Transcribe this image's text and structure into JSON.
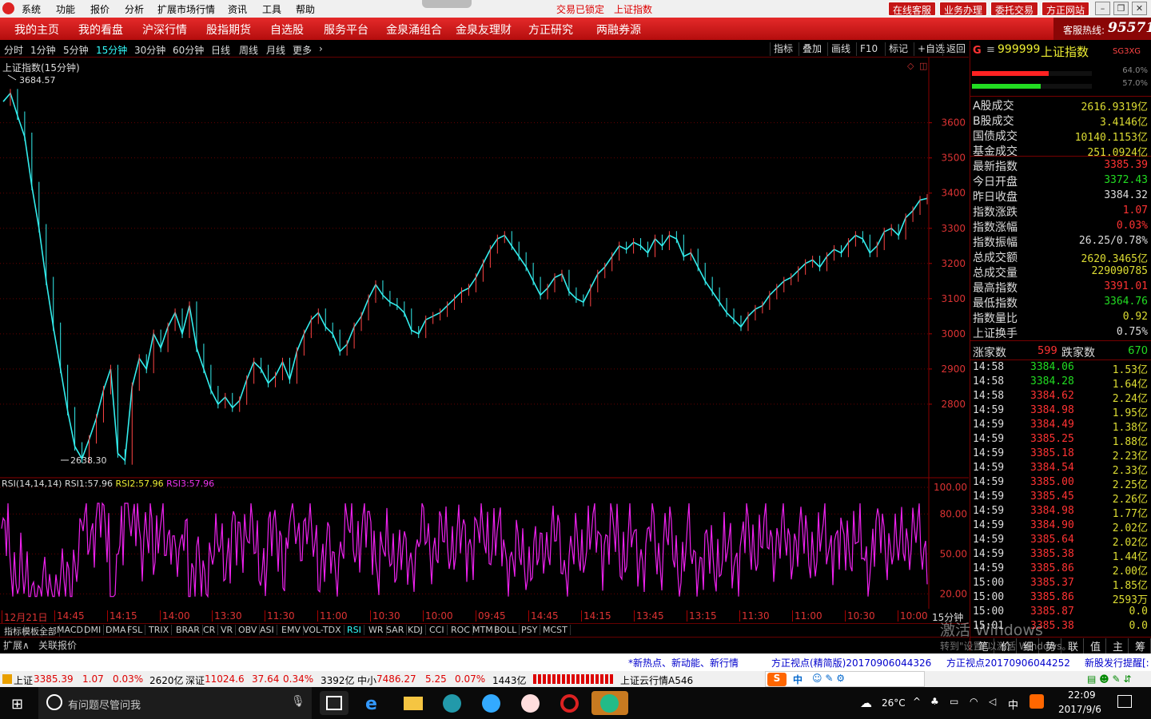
{
  "menu": {
    "items": [
      "系统",
      "功能",
      "报价",
      "分析",
      "扩展市场行情",
      "资讯",
      "工具",
      "帮助"
    ],
    "status": "交易已锁定",
    "title": "上证指数",
    "buttons": [
      "在线客服",
      "业务办理",
      "委托交易",
      "方正网站"
    ]
  },
  "nav": {
    "items": [
      "我的主页",
      "我的看盘",
      "沪深行情",
      "股指期货",
      "自选股",
      "服务平台",
      "金泉涌组合",
      "金泉友理财",
      "方正研究",
      "两融券源"
    ],
    "hotline_label": "客服热线:",
    "hotline": "95571"
  },
  "periods": {
    "items": [
      "分时",
      "1分钟",
      "5分钟",
      "15分钟",
      "30分钟",
      "60分钟",
      "日线",
      "周线",
      "月线",
      "更多"
    ],
    "active": 3
  },
  "tools": [
    "指标",
    "叠加",
    "画线",
    "F10",
    "标记",
    "+自选",
    "返回"
  ],
  "chart": {
    "title": "上证指数(15分钟)",
    "high_label": "3684.57",
    "low_label": "2638.30"
  },
  "rsi": {
    "name": "RSI(14,14,14)",
    "rsi1_label": "RSI1:",
    "rsi1": "57.96",
    "rsi2_label": "RSI2:",
    "rsi2": "57.96",
    "rsi3_label": "RSI3:",
    "rsi3": "57.96"
  },
  "chart_data": {
    "type": "line",
    "price_axis": {
      "ticks": [
        "3600",
        "3500",
        "3400",
        "3300",
        "3200",
        "3100",
        "3000",
        "2900",
        "2800"
      ],
      "ylim": [
        2600,
        3740
      ]
    },
    "rsi_axis": {
      "ticks": [
        "100.00",
        "80.00",
        "50.00",
        "20.00"
      ],
      "ylim": [
        10,
        100
      ]
    },
    "x_ticks": [
      "12月21日",
      "14:45",
      "14:15",
      "14:00",
      "13:30",
      "11:30",
      "11:00",
      "10:30",
      "10:00",
      "09:45",
      "14:45",
      "14:15",
      "13:45",
      "13:15",
      "11:30",
      "11:00",
      "10:30",
      "10:00"
    ],
    "x_unit": "15分钟",
    "series": [
      {
        "values": [
          3660,
          3684,
          3620,
          3560,
          3420,
          3300,
          3150,
          3020,
          2900,
          2780,
          2680,
          2645,
          2700,
          2760,
          2840,
          2900,
          2660,
          2640,
          2850,
          2930,
          2900,
          3000,
          2960,
          3020,
          3060,
          3000,
          3080,
          2960,
          2900,
          2840,
          2800,
          2820,
          2790,
          2810,
          2870,
          2920,
          2900,
          2860,
          2880,
          2920,
          2870,
          2950,
          3000,
          3040,
          3060,
          3020,
          3000,
          2950,
          2970,
          3020,
          3050,
          3100,
          3140,
          3110,
          3090,
          3080,
          3060,
          3010,
          3000,
          3040,
          3050,
          3060,
          3080,
          3100,
          3120,
          3130,
          3160,
          3200,
          3240,
          3270,
          3280,
          3250,
          3220,
          3190,
          3150,
          3110,
          3130,
          3160,
          3170,
          3120,
          3100,
          3090,
          3130,
          3170,
          3190,
          3220,
          3250,
          3240,
          3260,
          3250,
          3230,
          3270,
          3250,
          3280,
          3270,
          3220,
          3230,
          3190,
          3150,
          3120,
          3090,
          3060,
          3040,
          3020,
          3050,
          3070,
          3080,
          3110,
          3130,
          3150,
          3160,
          3180,
          3200,
          3210,
          3190,
          3220,
          3240,
          3230,
          3260,
          3280,
          3270,
          3230,
          3250,
          3290,
          3300,
          3280,
          3330,
          3350,
          3380,
          3385
        ]
      }
    ]
  },
  "right": {
    "code": "999999",
    "name": "上证指数",
    "tag": "SG3XG",
    "bar1_pct": "64.0%",
    "bar2_pct": "57.0%",
    "bar1_fill": 0.64,
    "bar2_fill": 0.57,
    "vol_rows": [
      [
        "A股成交",
        "2616.9319亿"
      ],
      [
        "B股成交",
        "3.4146亿"
      ],
      [
        "国债成交",
        "10140.1153亿"
      ],
      [
        "基金成交",
        "251.0924亿"
      ]
    ],
    "quote_rows": [
      [
        "最新指数",
        "3385.39",
        "#ff3333"
      ],
      [
        "今日开盘",
        "3372.43",
        "#22dd22"
      ],
      [
        "昨日收盘",
        "3384.32",
        "#dddddd"
      ],
      [
        "指数涨跌",
        "1.07",
        "#ff3333"
      ],
      [
        "指数涨幅",
        "0.03%",
        "#ff3333"
      ],
      [
        "指数振幅",
        "26.25/0.78%",
        "#dddddd"
      ],
      [
        "总成交额",
        "2620.3465亿",
        "#dddd33"
      ],
      [
        "总成交量",
        "229090785",
        "#dddd33"
      ],
      [
        "最高指数",
        "3391.01",
        "#ff3333"
      ],
      [
        "最低指数",
        "3364.76",
        "#22dd22"
      ],
      [
        "指数量比",
        "0.92",
        "#dddd33"
      ],
      [
        "上证换手",
        "0.75%",
        "#dddddd"
      ]
    ],
    "up_label": "涨家数",
    "up": "599",
    "down_label": "跌家数",
    "down": "670",
    "ticks": [
      [
        "14:58",
        "3384.06",
        "1.53亿",
        "#22dd22"
      ],
      [
        "14:58",
        "3384.28",
        "1.64亿",
        "#22dd22"
      ],
      [
        "14:58",
        "3384.62",
        "2.24亿",
        "#ff3333"
      ],
      [
        "14:59",
        "3384.98",
        "1.95亿",
        "#ff3333"
      ],
      [
        "14:59",
        "3384.49",
        "1.38亿",
        "#ff3333"
      ],
      [
        "14:59",
        "3385.25",
        "1.88亿",
        "#ff3333"
      ],
      [
        "14:59",
        "3385.18",
        "2.23亿",
        "#ff3333"
      ],
      [
        "14:59",
        "3384.54",
        "2.33亿",
        "#ff3333"
      ],
      [
        "14:59",
        "3385.00",
        "2.25亿",
        "#ff3333"
      ],
      [
        "14:59",
        "3385.45",
        "2.26亿",
        "#ff3333"
      ],
      [
        "14:59",
        "3384.98",
        "1.77亿",
        "#ff3333"
      ],
      [
        "14:59",
        "3384.90",
        "2.02亿",
        "#ff3333"
      ],
      [
        "14:59",
        "3385.64",
        "2.02亿",
        "#ff3333"
      ],
      [
        "14:59",
        "3385.38",
        "1.44亿",
        "#ff3333"
      ],
      [
        "14:59",
        "3385.86",
        "2.00亿",
        "#ff3333"
      ],
      [
        "15:00",
        "3385.37",
        "1.85亿",
        "#ff3333"
      ],
      [
        "15:00",
        "3385.86",
        "2593万",
        "#ff3333"
      ],
      [
        "15:00",
        "3385.87",
        "0.0",
        "#ff3333"
      ],
      [
        "15:01",
        "3385.38",
        "0.0",
        "#ff3333"
      ]
    ],
    "bottom_tabs": [
      "笔",
      "价",
      "细",
      "势",
      "联",
      "值",
      "主",
      "筹"
    ]
  },
  "indicator_tabs": [
    "指标",
    "模板",
    "全部",
    "MACD",
    "DMI",
    "DMA",
    "FSL",
    "TRIX",
    "BRAR",
    "CR",
    "VR",
    "OBV",
    "ASI",
    "EMV",
    "VOL-TDX",
    "RSI",
    "WR",
    "SAR",
    "KDJ",
    "CCI",
    "ROC",
    "MTM",
    "BOLL",
    "PSY",
    "MCST"
  ],
  "ext": {
    "expand": "扩展∧",
    "close": "关联报价"
  },
  "news": [
    "*新热点、新动能、新行情",
    "方正视点(精简版)20170906044326",
    "方正视点20170906044252",
    "新股发行提醒[:"
  ],
  "status": {
    "sh_label": "上证",
    "sh": "3385.39",
    "sh_chg": "1.07",
    "sh_pct": "0.03%",
    "sh_amt": "2620亿",
    "sz_label": "深证",
    "sz": "11024.6",
    "sz_chg": "37.64",
    "sz_pct": "0.34%",
    "sz_amt": "3392亿",
    "zx_label": "中小",
    "zx": "7486.27",
    "zx_chg": "5.25",
    "zx_pct": "0.07%",
    "zx_amt": "1443亿",
    "cloud": "上证云行情A546"
  },
  "taskbar": {
    "search": "有问题尽管问我",
    "weather": "26°C",
    "ime": "中",
    "time": "22:09",
    "date": "2017/9/6"
  },
  "watermark": {
    "line1": "激活 Windows",
    "line2": "转到\"设置\"以激活 Windows。"
  }
}
